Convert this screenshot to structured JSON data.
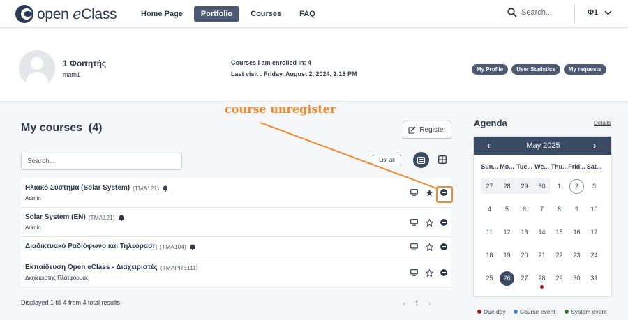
{
  "nav": {
    "logo_text_pre": "open ",
    "logo_text_em": "e",
    "logo_text_post": "Class",
    "items": [
      {
        "label": "Home Page",
        "active": false
      },
      {
        "label": "Portfolio",
        "active": true
      },
      {
        "label": "Courses",
        "active": false
      },
      {
        "label": "FAQ",
        "active": false
      }
    ],
    "search_placeholder": "Search...",
    "user_initials": "Φ1"
  },
  "profile": {
    "name": "1 Φοιτητής",
    "username": "math1",
    "enrolled": "Courses I am enrolled in: 4",
    "last_visit": "Last visit : Friday, August 2, 2024, 2:18 PM",
    "buttons": [
      "My Profile",
      "User Statistics",
      "My requests"
    ]
  },
  "courses_section": {
    "title": "My courses  (4)",
    "register_label": "Register",
    "search_placeholder": "Search...",
    "list_all_label": "List all",
    "annotation": "course unregister",
    "courses": [
      {
        "name": "Ηλιακό Σύστημα (Solar System)",
        "code": "(TMA121)",
        "sub": "Admin",
        "favorite": true
      },
      {
        "name": "Solar System (EN)",
        "code": "(TMA121)",
        "sub": "Admin",
        "favorite": false
      },
      {
        "name": "Διαδικτυακό Ραδιόφωνο και Τηλεόραση",
        "code": "(TMA104)",
        "sub": "",
        "favorite": false
      },
      {
        "name": "Εκπαίδευση Open eClass - Διαχειριστές",
        "code": "(TMAPRE111)",
        "sub": "Διαχειριστής Πλατφόρμας",
        "favorite": false
      }
    ],
    "footer_text": "Displayed 1 till 4 from 4 total results",
    "pager": {
      "prev": "‹",
      "page": "1",
      "next": "›"
    }
  },
  "agenda": {
    "title": "Agenda",
    "details_label": "Details",
    "month": "May 2025",
    "weekdays": [
      "Sun...",
      "Mo...",
      "Tue...",
      "We...",
      "Thu...",
      "Frid...",
      "Sat..."
    ],
    "weeks": [
      [
        "27",
        "28",
        "29",
        "30",
        "1",
        "2",
        "3"
      ],
      [
        "4",
        "5",
        "6",
        "7",
        "8",
        "9",
        "10"
      ],
      [
        "11",
        "12",
        "13",
        "14",
        "15",
        "16",
        "17"
      ],
      [
        "18",
        "19",
        "20",
        "21",
        "22",
        "23",
        "24"
      ],
      [
        "25",
        "26",
        "27",
        "28",
        "29",
        "30",
        "31"
      ]
    ],
    "today": "2",
    "selected": "26",
    "event_day": "28",
    "legend": [
      {
        "label": "Due day",
        "color": "#a01818"
      },
      {
        "label": "Course event",
        "color": "#3d7fd6"
      },
      {
        "label": "System event",
        "color": "#2a7a2a"
      }
    ]
  }
}
